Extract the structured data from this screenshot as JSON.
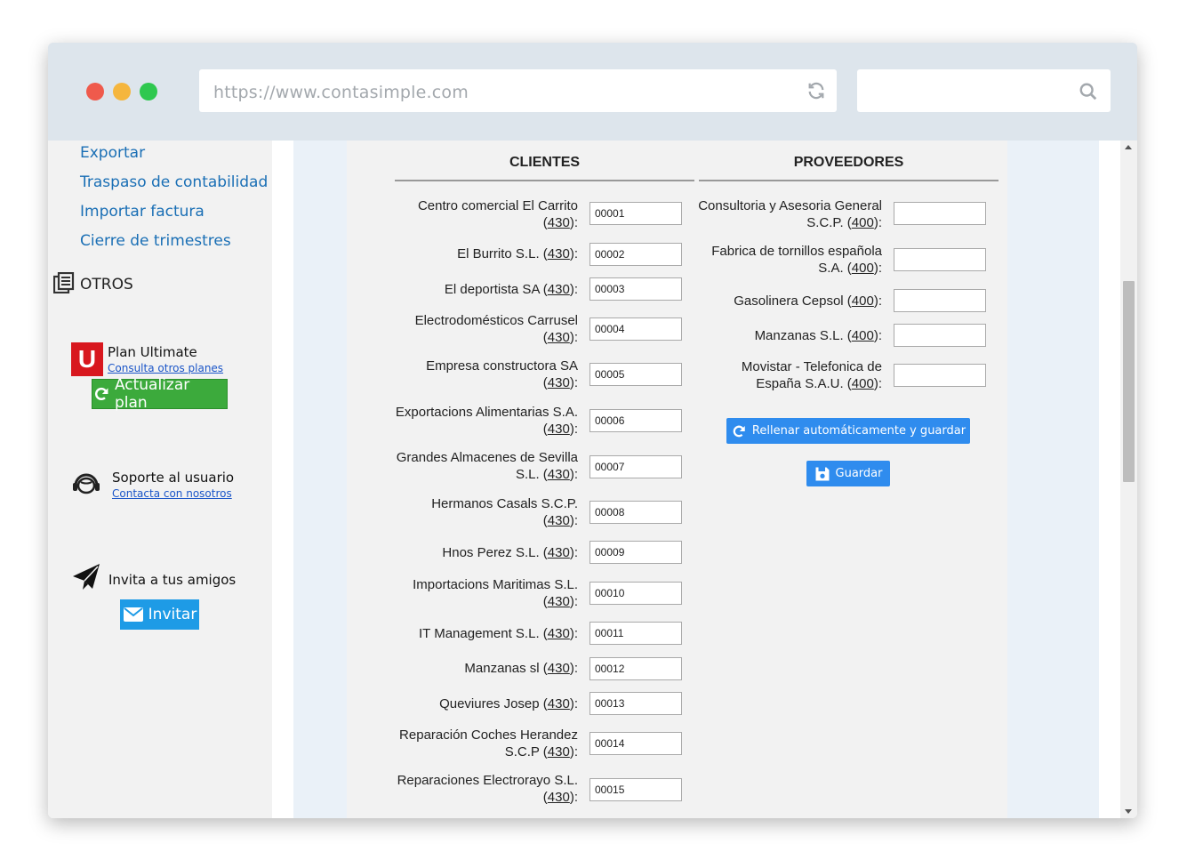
{
  "browser": {
    "url": "https://www.contasimple.com",
    "search_value": ""
  },
  "sidebar": {
    "links": [
      "Exportar",
      "Traspaso de contabilidad",
      "Importar factura",
      "Cierre de trimestres"
    ],
    "section_label": "OTROS",
    "plan": {
      "badge": "U",
      "title": "Plan Ultimate",
      "link": "Consulta otros planes",
      "button": "Actualizar plan"
    },
    "support": {
      "title": "Soporte al usuario",
      "link": "Contacta con nosotros"
    },
    "invite": {
      "title": "Invita a tus amigos",
      "button": "Invitar"
    }
  },
  "clients": {
    "heading": "CLIENTES",
    "rows": [
      {
        "name": "Centro comercial El Carrito",
        "account": "430",
        "value": "00001"
      },
      {
        "name": "El Burrito S.L.",
        "account": "430",
        "value": "00002"
      },
      {
        "name": "El deportista SA",
        "account": "430",
        "value": "00003"
      },
      {
        "name": "Electrodomésticos Carrusel",
        "account": "430",
        "value": "00004"
      },
      {
        "name": "Empresa constructora SA",
        "account": "430",
        "value": "00005"
      },
      {
        "name": "Exportacions Alimentarias S.A.",
        "account": "430",
        "value": "00006"
      },
      {
        "name": "Grandes Almacenes de Sevilla S.L.",
        "account": "430",
        "value": "00007"
      },
      {
        "name": "Hermanos Casals S.C.P.",
        "account": "430",
        "value": "00008"
      },
      {
        "name": "Hnos Perez S.L.",
        "account": "430",
        "value": "00009"
      },
      {
        "name": "Importacions Maritimas S.L.",
        "account": "430",
        "value": "00010"
      },
      {
        "name": "IT Management S.L.",
        "account": "430",
        "value": "00011"
      },
      {
        "name": "Manzanas sl",
        "account": "430",
        "value": "00012"
      },
      {
        "name": "Queviures Josep",
        "account": "430",
        "value": "00013"
      },
      {
        "name": "Reparación Coches Herandez S.C.P",
        "account": "430",
        "value": "00014"
      },
      {
        "name": "Reparaciones Electrorayo S.L.",
        "account": "430",
        "value": "00015"
      }
    ]
  },
  "suppliers": {
    "heading": "PROVEEDORES",
    "rows": [
      {
        "name": "Consultoria y Asesoria General S.C.P.",
        "account": "400",
        "value": ""
      },
      {
        "name": "Fabrica de tornillos española S.A.",
        "account": "400",
        "value": ""
      },
      {
        "name": "Gasolinera Cepsol",
        "account": "400",
        "value": ""
      },
      {
        "name": "Manzanas S.L.",
        "account": "400",
        "value": ""
      },
      {
        "name": "Movistar - Telefonica de España S.A.U.",
        "account": "400",
        "value": ""
      }
    ],
    "autofill_button": "Rellenar automáticamente y guardar",
    "save_button": "Guardar"
  },
  "colors": {
    "link": "#1a6fb5",
    "upgrade_green": "#3caa3c",
    "action_blue": "#2f8cee",
    "plan_red": "#d8171e"
  }
}
